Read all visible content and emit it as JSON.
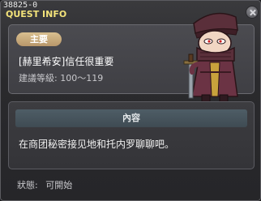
{
  "window": {
    "quest_id": "38825-0",
    "title": "QUEST INFO"
  },
  "summary": {
    "type_badge": "主要",
    "quest_name": "[赫里希安]信任很重要",
    "level_label": "建議等級:",
    "level_range": "100～119",
    "npc_icon": "npc-portrait"
  },
  "content": {
    "header": "內容",
    "text": "在商团秘密接见地和托内罗聊聊吧。"
  },
  "status": {
    "label": "狀態:",
    "value": "可開始"
  },
  "colors": {
    "title": "#f2e27a",
    "badge": "#c9a97a",
    "content_header": "#475660"
  }
}
